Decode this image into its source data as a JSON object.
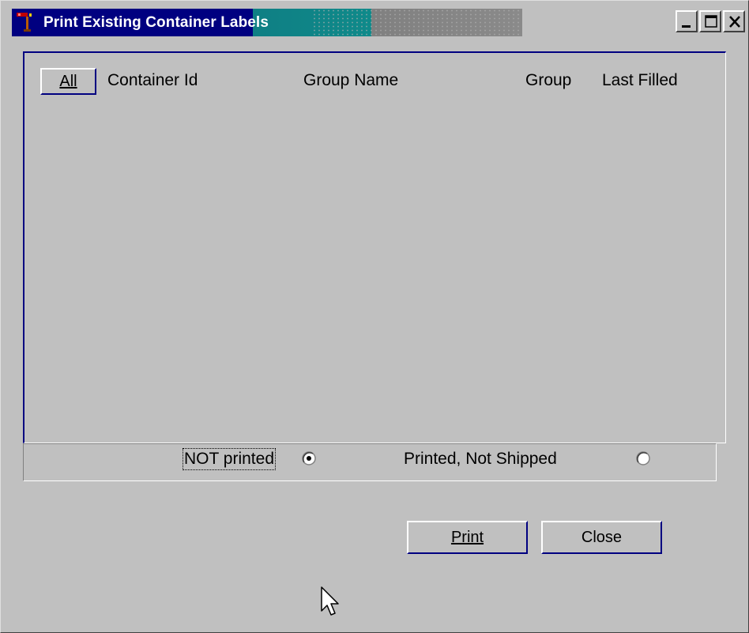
{
  "window": {
    "title": "Print Existing Container Labels",
    "controls": [
      "minimize",
      "maximize",
      "close"
    ]
  },
  "list": {
    "all_button": "All",
    "columns": [
      "Container Id",
      "Group Name",
      "Group",
      "Last Filled"
    ],
    "rows": []
  },
  "filter": {
    "options": [
      {
        "label": "NOT printed",
        "selected": true
      },
      {
        "label": "Printed, Not Shipped",
        "selected": false
      }
    ]
  },
  "buttons": {
    "print": "Print",
    "close": "Close"
  },
  "icons": {
    "app_icon": "app-icon",
    "cursor": "arrow-cursor-icon"
  },
  "colors": {
    "title_active": "#000080",
    "face": "#c0c0c0"
  }
}
